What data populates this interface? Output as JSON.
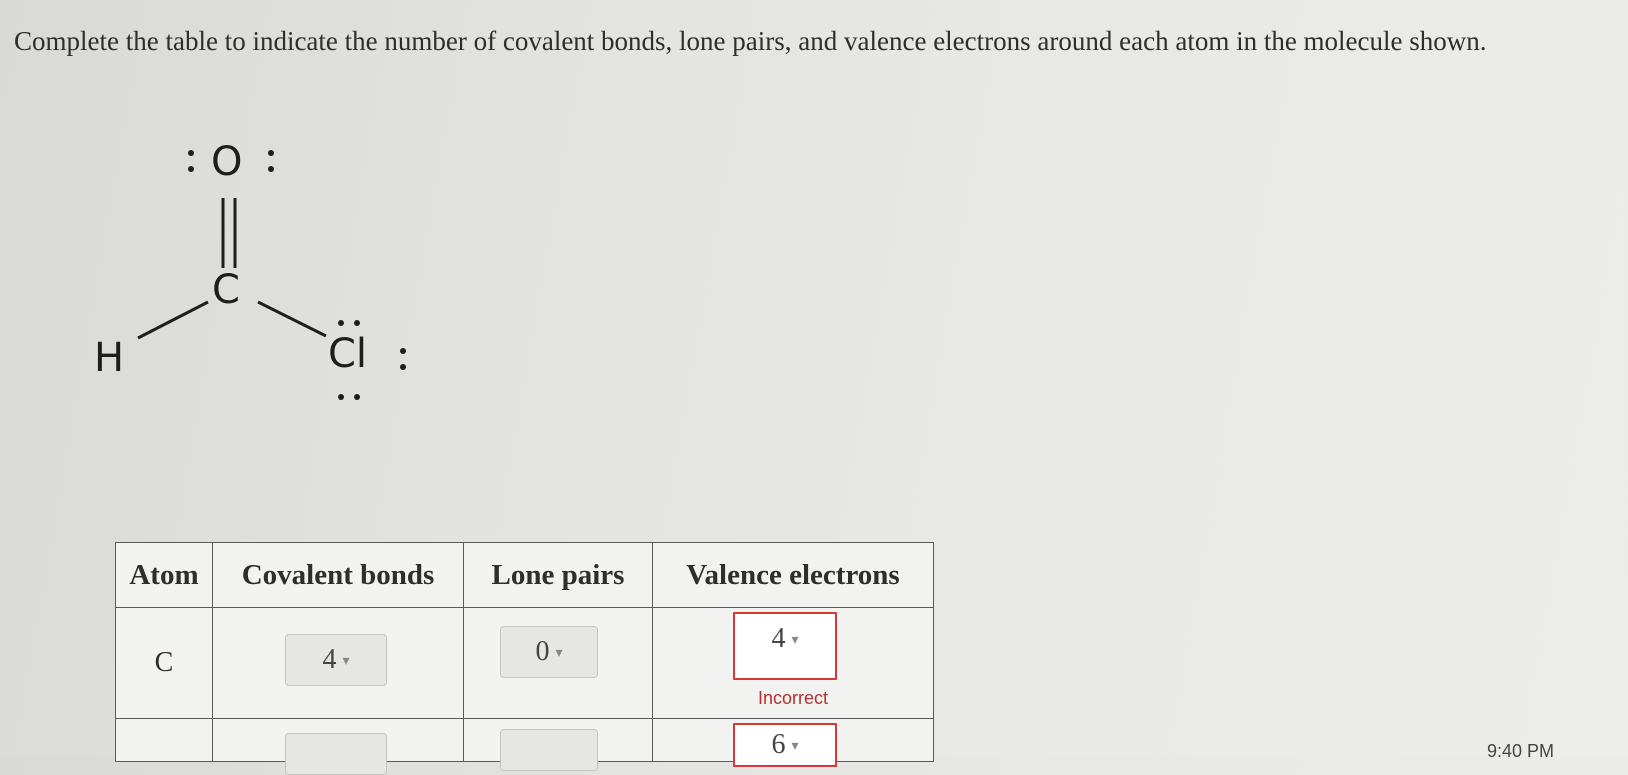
{
  "question": {
    "text": "Complete the table to indicate the number of covalent bonds, lone pairs, and valence electrons around each atom in the molecule shown."
  },
  "molecule": {
    "atoms": {
      "oxygen": "O",
      "carbon": "C",
      "hydrogen": "H",
      "chlorine": "Cl"
    }
  },
  "table": {
    "headers": {
      "atom": "Atom",
      "covalent_bonds": "Covalent bonds",
      "lone_pairs": "Lone pairs",
      "valence_electrons": "Valence electrons"
    },
    "rows": [
      {
        "atom": "C",
        "covalent_bonds": "4",
        "lone_pairs": "0",
        "valence_electrons": "4",
        "feedback": "Incorrect"
      },
      {
        "atom": "",
        "covalent_bonds": "",
        "lone_pairs": "",
        "valence_electrons": "6",
        "feedback": ""
      }
    ]
  },
  "colors": {
    "error": "#d83838",
    "background": "#e3e3e1"
  },
  "taskbar": {
    "time": "9:40 PM"
  }
}
